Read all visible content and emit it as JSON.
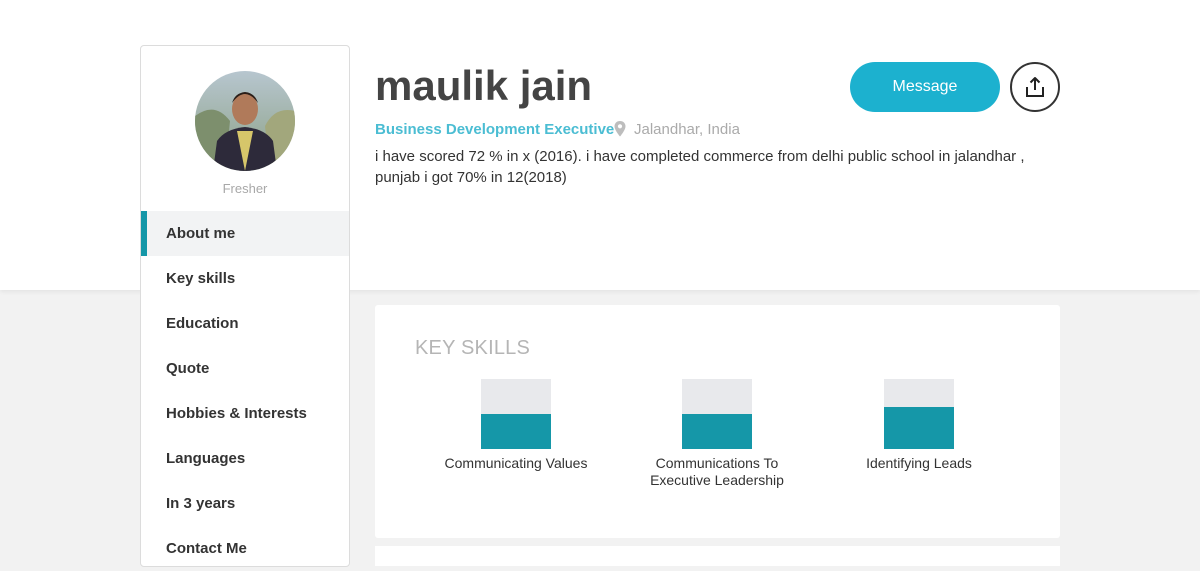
{
  "colors": {
    "accent": "#1597a8",
    "accent2": "#1cb1cf"
  },
  "profile": {
    "name": "maulik jain",
    "title": "Business Development Executive",
    "location": "Jalandhar, India",
    "status": "Fresher",
    "bio": "i have scored 72 % in x (2016). i have completed commerce from delhi public school in jalandhar , punjab i got 70% in 12(2018)"
  },
  "actions": {
    "message_label": "Message",
    "share_icon": "share-icon"
  },
  "sidebar": {
    "items": [
      {
        "label": "About me",
        "active": true
      },
      {
        "label": "Key skills"
      },
      {
        "label": "Education"
      },
      {
        "label": "Quote"
      },
      {
        "label": "Hobbies & Interests"
      },
      {
        "label": "Languages"
      },
      {
        "label": "In 3 years"
      },
      {
        "label": "Contact Me"
      }
    ]
  },
  "skills": {
    "title": "KEY SKILLS",
    "items": [
      {
        "label": "Communicating Values",
        "level": 0.5
      },
      {
        "label": "Communications To Executive Leadership",
        "level": 0.5
      },
      {
        "label": "Identifying Leads",
        "level": 0.6
      }
    ]
  }
}
